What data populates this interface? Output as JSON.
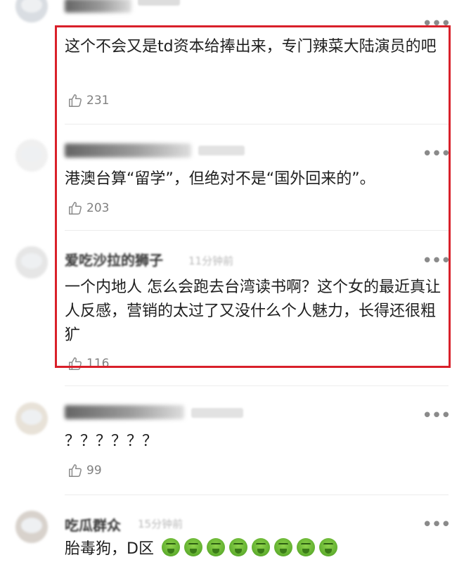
{
  "comments": [
    {
      "text": "这个不会又是td资本给捧出来，专门辣菜大陆演员的吧",
      "likes": "231"
    },
    {
      "text": "港澳台算“留学”，但绝对不是“国外回来的”。",
      "likes": "203"
    },
    {
      "name": "爱吃沙拉的狮子",
      "time": "11分钟前",
      "text": "一个内地人 怎么会跑去台湾读书啊？这个女的最近真让人反感，营销的太过了又没什么个人魅力，长得还很粗犷",
      "likes": "116"
    },
    {
      "text": "？？？？？？",
      "likes": "99"
    },
    {
      "name": "吃瓜群众",
      "time": "15分钟前",
      "text": "胎毒狗，D区"
    }
  ],
  "icons": {
    "more": "more-dots-icon",
    "like": "thumbs-up-icon",
    "emoji": "nauseated-face-emoji"
  },
  "colors": {
    "highlight_border": "#d9202a"
  }
}
